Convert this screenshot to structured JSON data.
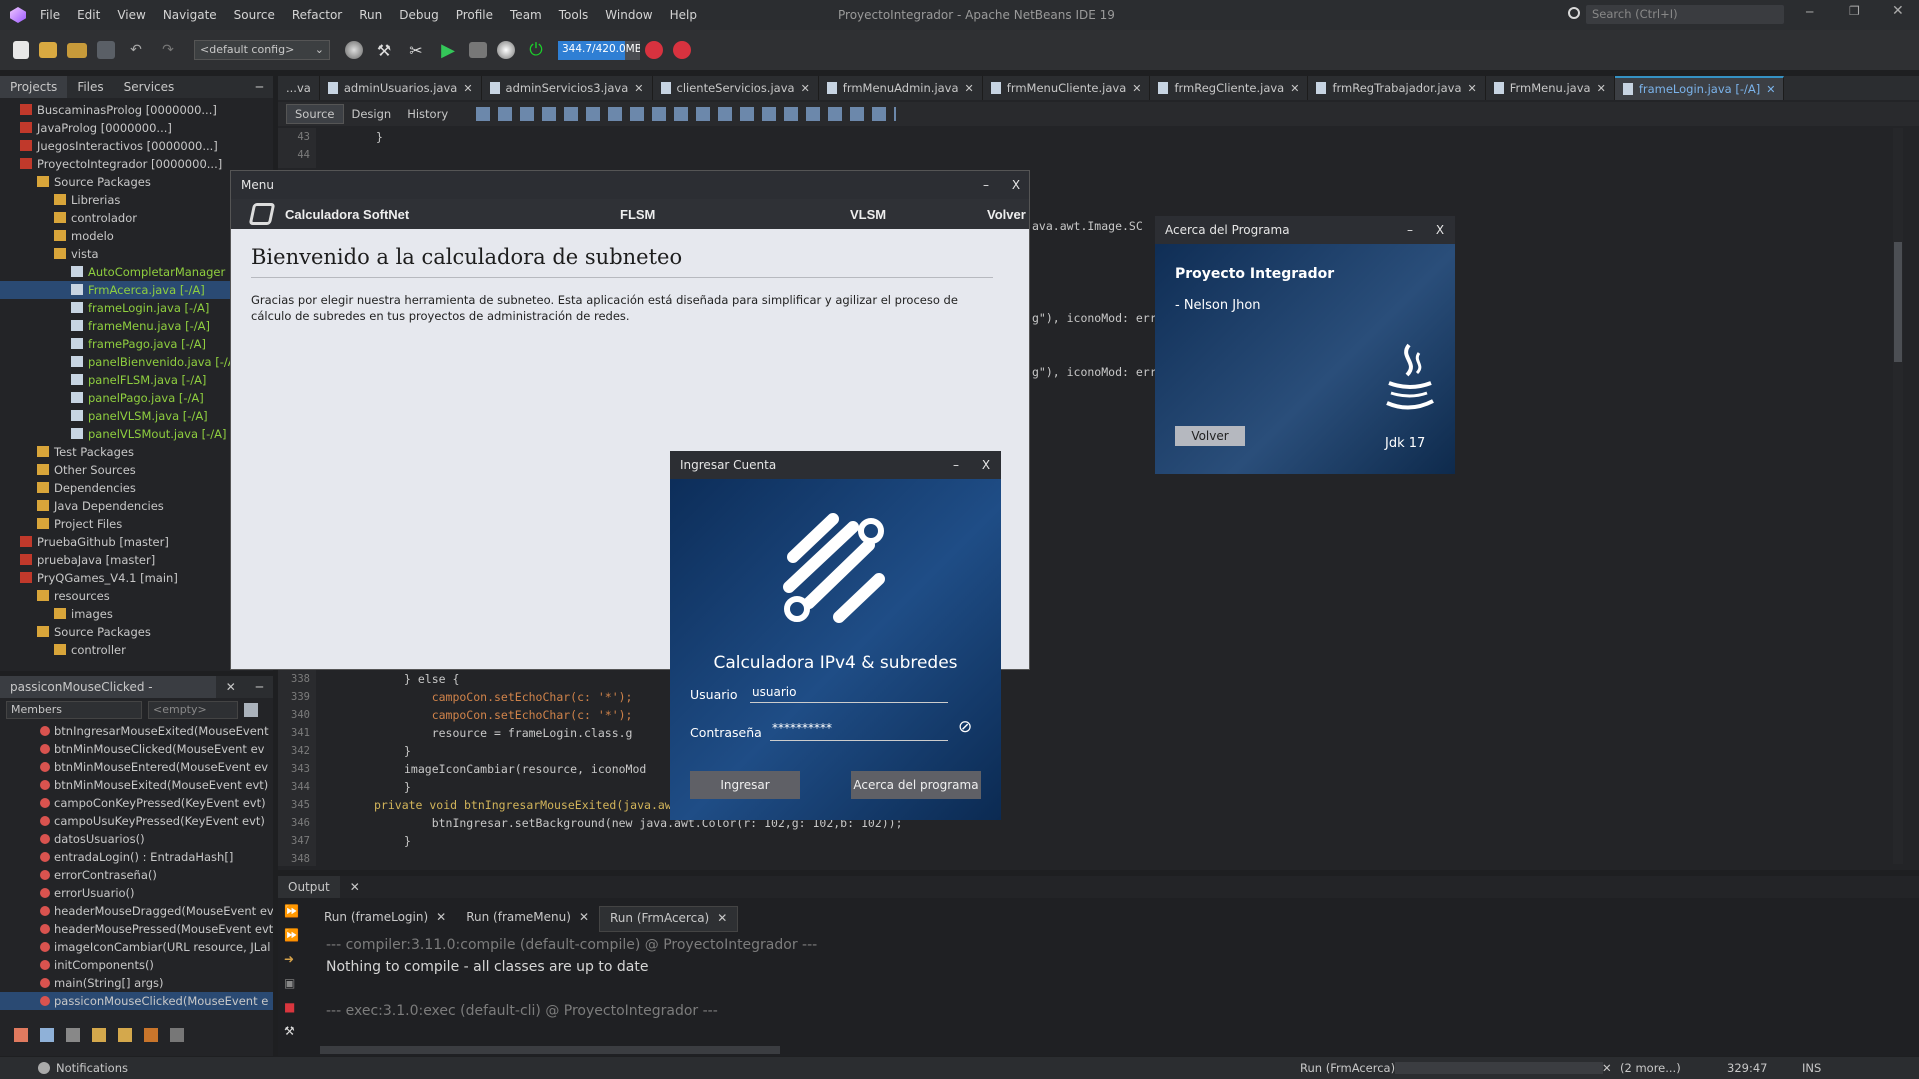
{
  "window": {
    "title": "ProyectoIntegrador - Apache NetBeans IDE 19",
    "search_placeholder": "Search (Ctrl+I)"
  },
  "menubar": [
    "File",
    "Edit",
    "View",
    "Navigate",
    "Source",
    "Refactor",
    "Run",
    "Debug",
    "Profile",
    "Team",
    "Tools",
    "Window",
    "Help"
  ],
  "toolbar": {
    "config": "<default config>",
    "memory": "344.7/420.0MB",
    "memory_fraction": 0.82
  },
  "projects_panel": {
    "tabs": [
      "Projects",
      "Files",
      "Services"
    ],
    "rows": [
      "BuscaminasProlog [0000000...]",
      "JavaProlog [0000000...]",
      "JuegosInteractivos [0000000...]",
      "ProyectoIntegrador [0000000...]",
      "Source Packages",
      "Librerias",
      "controlador",
      "modelo",
      "vista",
      "AutoCompletarManager",
      "FrmAcerca.java [-/A]",
      "frameLogin.java [-/A]",
      "frameMenu.java [-/A]",
      "framePago.java [-/A]",
      "panelBienvenido.java [-/A]",
      "panelFLSM.java [-/A]",
      "panelPago.java [-/A]",
      "panelVLSM.java [-/A]",
      "panelVLSMout.java [-/A]",
      "Test Packages",
      "Other Sources",
      "Dependencies",
      "Java Dependencies",
      "Project Files",
      "PruebaGithub [master]",
      "pruebaJava [master]",
      "PryQGames_V4.1 [main]",
      "resources",
      "images",
      "Source Packages",
      "controller"
    ]
  },
  "navigator_panel": {
    "title": "passiconMouseClicked - Navigator",
    "filter": "Members",
    "scope": "<empty>",
    "items": [
      "btnIngresarMouseExited(MouseEvent",
      "btnMinMouseClicked(MouseEvent ev",
      "btnMinMouseEntered(MouseEvent ev",
      "btnMinMouseExited(MouseEvent evt)",
      "campoConKeyPressed(KeyEvent evt)",
      "campoUsuKeyPressed(KeyEvent evt)",
      "datosUsuarios()",
      "entradaLogin() : EntradaHash[]",
      "errorContraseña()",
      "errorUsuario()",
      "headerMouseDragged(MouseEvent ev",
      "headerMousePressed(MouseEvent evt",
      "imageIconCambiar(URL resource, JLal",
      "initComponents()",
      "main(String[] args)",
      "passiconMouseClicked(MouseEvent e"
    ]
  },
  "editor_tabs": [
    "...va",
    "adminUsuarios.java",
    "adminServicios3.java",
    "clienteServicios.java",
    "frmMenuAdmin.java",
    "frmMenuCliente.java",
    "frmRegCliente.java",
    "frmRegTrabajador.java",
    "FrmMenu.java",
    "frameLogin.java [-/A]"
  ],
  "editor_subtabs": [
    "Source",
    "Design",
    "History"
  ],
  "code_top": {
    "lines": [
      "43",
      "44"
    ],
    "text": [
      "}",
      ""
    ]
  },
  "code_right_fragments": [
    "ava.awt.Image.SC",
    "g\"), iconoMod: erro",
    "g\"), iconoMod: erro"
  ],
  "code_bottom": {
    "lines": [
      "338",
      "339",
      "340",
      "341",
      "342",
      "343",
      "344",
      "345",
      "346",
      "347",
      "348"
    ],
    "text": [
      "} else {",
      "    campoCon.setEchoChar(c: '*');",
      "    campoCon.setEchoChar(c: '*');",
      "    resource = frameLogin.class.g",
      "}",
      "imageIconCambiar(resource, iconoMod",
      "}",
      "",
      "private void btnIngresarMouseExited(java.awt.event.MouseEvent evt) {",
      "    btnIngresar.setBackground(new java.awt.Color(r: 102,g: 102,b: 102));",
      "}"
    ]
  },
  "menu_window": {
    "title": "Menu",
    "brand": "Calculadora SoftNet",
    "nav": [
      "FLSM",
      "VLSM",
      "Volver"
    ],
    "heading": "Bienvenido a la calculadora de subneteo",
    "body": "Gracias por elegir nuestra herramienta de subneteo. Esta aplicación está diseñada para simplificar y agilizar el proceso de cálculo de subredes en tus proyectos de administración de redes."
  },
  "about_window": {
    "title": "Acerca del Programa",
    "heading": "Proyecto Integrador",
    "author": "- Nelson Jhon",
    "back": "Volver",
    "jdk": "Jdk 17"
  },
  "login_window": {
    "title": "Ingresar Cuenta",
    "heading": "Calculadora IPv4 & subredes",
    "user_label": "Usuario",
    "user_value": "usuario",
    "pass_label": "Contraseña",
    "pass_value": "**********",
    "login_button": "Ingresar",
    "about_button": "Acerca del programa"
  },
  "output": {
    "title": "Output",
    "tabs": [
      "Run (frameLogin)",
      "Run (frameMenu)",
      "Run (FrmAcerca)"
    ],
    "lines": [
      "--- compiler:3.11.0:compile (default-compile) @ ProyectoIntegrador ---",
      "Nothing to compile - all classes are up to date",
      "",
      "--- exec:3.1.0:exec (default-cli) @ ProyectoIntegrador ---"
    ]
  },
  "status": {
    "notifications": "Notifications",
    "run": "Run (FrmAcerca)",
    "more": "(2 more...)",
    "position": "329:47",
    "mode": "INS"
  },
  "colors": {
    "accent": "#3592c4",
    "java_blue": "#5aa5ff",
    "code_yellow": "#d2b45a"
  }
}
